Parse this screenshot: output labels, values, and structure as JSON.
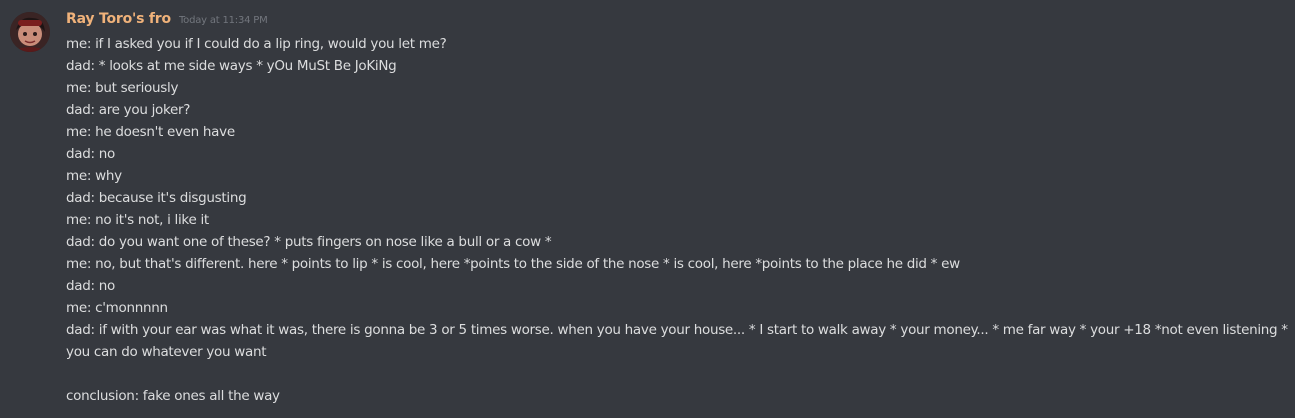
{
  "message": {
    "author": "Ray Toro's fro",
    "timestamp": "Today at 11:34 PM",
    "avatar_icon": "user-avatar",
    "username_color": "#f0b27a",
    "lines": [
      "me: if I asked you if I could do a lip ring, would you let me?",
      "dad: * looks at me side ways * yOu MuSt Be JoKiNg",
      "me: but seriously",
      "dad: are you joker?",
      "me: he doesn't even have",
      "dad: no",
      "me: why",
      "dad: because it's disgusting",
      "me: no it's not, i like it",
      "dad: do you want one of these? * puts fingers on nose like a bull or a cow *",
      "me: no, but that's different. here * points to lip * is cool, here *points to the side of the nose * is cool, here *points to the place he did * ew",
      "dad: no",
      "me: c'monnnnn",
      "dad: if with your ear was what it was, there is gonna be 3 or 5 times worse. when you have your house... * I start to walk away * your money... * me far way * your +18 *not even listening *",
      "you can do whatever you want",
      "",
      "conclusion: fake ones all the way"
    ]
  }
}
